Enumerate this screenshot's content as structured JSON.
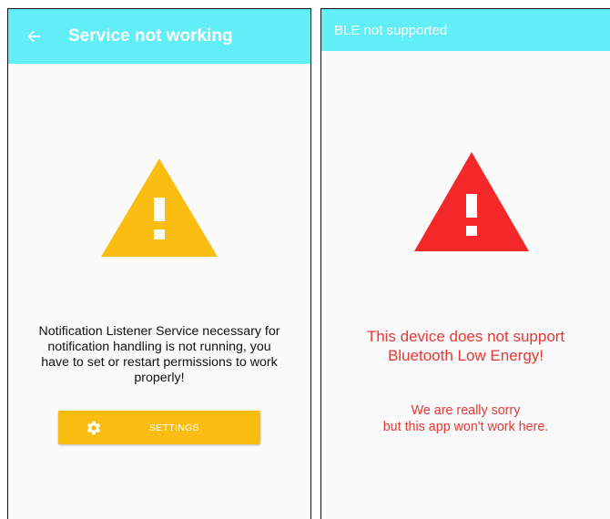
{
  "left_screen": {
    "title": "Service not working",
    "message": "Notification Listener Service necessary for notification handling is not running, you have to set or restart permissions to work properly!",
    "settings_button_label": "SETTINGS",
    "warning_color": "#fcbd12"
  },
  "right_screen": {
    "title": "BLE not supported",
    "message_primary": "This device does not support Bluetooth Low Energy!",
    "message_secondary": "We are really sorry\nbut this app won't work here.",
    "warning_color": "#f42828"
  },
  "colors": {
    "app_bar": "#62eef6",
    "accent": "#fcbd12",
    "error_text": "#e53935"
  },
  "icons": {
    "back": "arrow-back-icon",
    "settings": "gear-icon",
    "warning": "warning-triangle-icon"
  }
}
